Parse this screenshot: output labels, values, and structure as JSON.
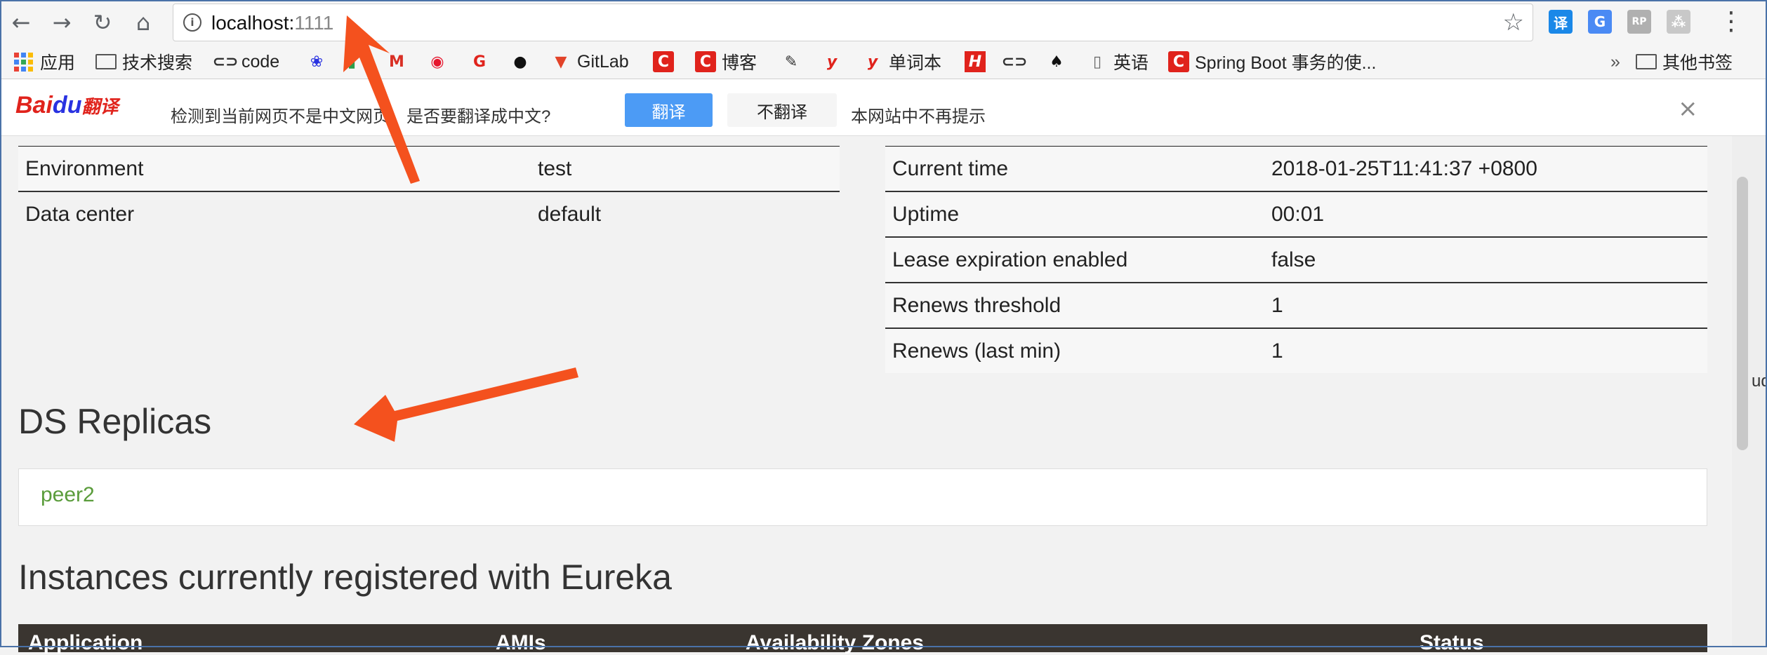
{
  "browser": {
    "url_host": "localhost:",
    "url_port": "1111",
    "nav_icons": [
      "back-icon",
      "forward-icon",
      "reload-icon",
      "home-icon"
    ],
    "extensions": [
      {
        "name": "translate-extension-icon",
        "glyph": "译",
        "color": "#1a88e8"
      },
      {
        "name": "google-translate-icon",
        "glyph": "G",
        "color": "#4a8af4"
      },
      {
        "name": "rp-extension-icon",
        "glyph": "RP",
        "color": "#b0b0b0"
      },
      {
        "name": "puzzle-extension-icon",
        "glyph": "⁂",
        "color": "#c8c8c8"
      }
    ]
  },
  "bookmarks": {
    "items": [
      {
        "label": "应用",
        "icon": "apps-grid-icon"
      },
      {
        "label": "技术搜索",
        "icon": "folder-icon"
      },
      {
        "label": "code",
        "icon": "link-icon"
      },
      {
        "label": "",
        "icon": "baidu-paw-icon"
      },
      {
        "label": "",
        "icon": "green-bookmark-icon"
      },
      {
        "label": "",
        "icon": "gmail-icon"
      },
      {
        "label": "",
        "icon": "weibo-icon"
      },
      {
        "label": "",
        "icon": "g-red-icon"
      },
      {
        "label": "",
        "icon": "github-icon"
      },
      {
        "label": "GitLab",
        "icon": "gitlab-icon"
      },
      {
        "label": "",
        "icon": "csdn-icon"
      },
      {
        "label": "博客",
        "icon": "csdn-blog-icon"
      },
      {
        "label": "",
        "icon": "feather-icon"
      },
      {
        "label": "",
        "icon": "youdao-icon"
      },
      {
        "label": "单词本",
        "icon": "youdao-wordbook-icon"
      },
      {
        "label": "",
        "icon": "h-red-icon"
      },
      {
        "label": "",
        "icon": "link-icon"
      },
      {
        "label": "",
        "icon": "spade-icon"
      },
      {
        "label": "英语",
        "icon": "page-icon"
      },
      {
        "label": "Spring Boot 事务的使...",
        "icon": "csdn-icon"
      }
    ],
    "overflow": "»",
    "other_bookmarks": "其他书签"
  },
  "translate_bar": {
    "logo_part1": "Bai",
    "logo_part2": "du",
    "logo_part3": "翻译",
    "prompt": "检测到当前网页不是中文网页，是否要翻译成中文?",
    "translate_button": "翻译",
    "dont_translate_button": "不翻译",
    "never_for_site": "本网站中不再提示",
    "close": "×"
  },
  "system_status": {
    "left": [
      {
        "label": "Environment",
        "value": "test"
      },
      {
        "label": "Data center",
        "value": "default"
      }
    ],
    "right": [
      {
        "label": "Current time",
        "value": "2018-01-25T11:41:37 +0800"
      },
      {
        "label": "Uptime",
        "value": "00:01"
      },
      {
        "label": "Lease expiration enabled",
        "value": "false"
      },
      {
        "label": "Renews threshold",
        "value": "1"
      },
      {
        "label": "Renews (last min)",
        "value": "1"
      }
    ]
  },
  "ds_replicas": {
    "title": "DS Replicas",
    "items": [
      "peer2"
    ]
  },
  "instances": {
    "title": "Instances currently registered with Eureka",
    "columns": [
      "Application",
      "AMIs",
      "Availability Zones",
      "Status"
    ]
  },
  "scroll_sliver_text": "ud",
  "annotation_color": "#f4511e"
}
